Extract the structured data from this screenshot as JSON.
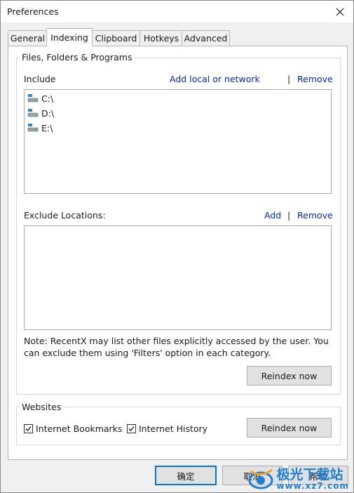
{
  "window": {
    "title": "Preferences"
  },
  "tabs": [
    {
      "label": "General"
    },
    {
      "label": "Indexing"
    },
    {
      "label": "Clipboard"
    },
    {
      "label": "Hotkeys"
    },
    {
      "label": "Advanced"
    }
  ],
  "files_group": {
    "legend": "Files, Folders & Programs",
    "include_label": "Include",
    "include_add_link": "Add local or network",
    "separator": "|",
    "include_remove_link": "Remove",
    "include_items": [
      {
        "label": "C:\\"
      },
      {
        "label": "D:\\"
      },
      {
        "label": "E:\\"
      }
    ],
    "exclude_label": "Exclude Locations:",
    "exclude_add_link": "Add",
    "exclude_remove_link": "Remove",
    "note": "Note: RecentX may list other files explicitly accessed by the user. You can exclude them using 'Filters' option in each category.",
    "reindex_button": "Reindex now"
  },
  "websites_group": {
    "legend": "Websites",
    "bookmarks_label": "Internet Bookmarks",
    "bookmarks_checked": true,
    "history_label": "Internet History",
    "history_checked": true,
    "reindex_button": "Reindex now"
  },
  "footer": {
    "ok_button": "确定",
    "cancel_button": "取消",
    "help_button": "帮助"
  },
  "watermark": {
    "brand": "极光下载站",
    "url": "www.xz7.com"
  },
  "colors": {
    "link": "#0026d6",
    "accent": "#0078d7",
    "watermark_blue": "#1e7fd8"
  }
}
